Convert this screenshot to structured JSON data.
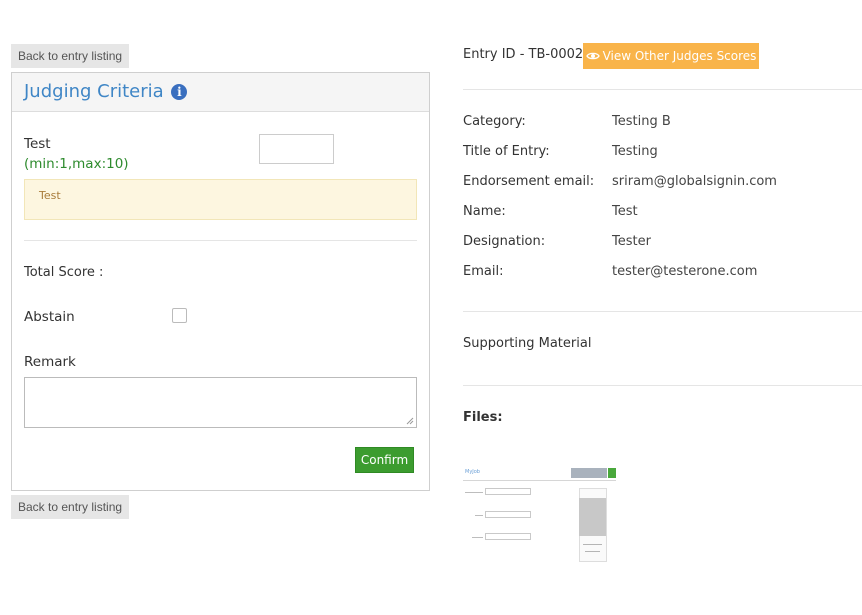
{
  "nav": {
    "back_top": "Back to entry listing",
    "back_bottom": "Back to entry listing"
  },
  "judging": {
    "title": "Judging Criteria",
    "info_icon": "info-circle-icon",
    "criterion_label": "Test",
    "criterion_range": "(min:1,max:10)",
    "score_value": "",
    "note": "Test",
    "total_score_label": "Total Score :",
    "total_score_value": "",
    "abstain_label": "Abstain",
    "abstain_checked": false,
    "remark_label": "Remark",
    "remark_value": "",
    "confirm_label": "Confirm"
  },
  "entry": {
    "id_label": "Entry ID - TB-0002",
    "view_scores_label": "View Other Judges Scores",
    "view_scores_icon": "eye-icon",
    "fields": [
      {
        "key": "Category:",
        "value": "Testing B"
      },
      {
        "key": "Title of Entry:",
        "value": "Testing"
      },
      {
        "key": "Endorsement email:",
        "value": "sriram@globalsignin.com"
      },
      {
        "key": "Name:",
        "value": "Test"
      },
      {
        "key": "Designation:",
        "value": "Tester"
      },
      {
        "key": "Email:",
        "value": "tester@testerone.com"
      }
    ],
    "supporting_material_label": "Supporting Material",
    "files_label": "Files:"
  },
  "colors": {
    "accent_blue": "#3f86c6",
    "confirm_green": "#3c9c2f",
    "scores_orange": "#f9b44a",
    "range_green": "#2e8b2e",
    "note_bg": "#fdf6e0"
  }
}
